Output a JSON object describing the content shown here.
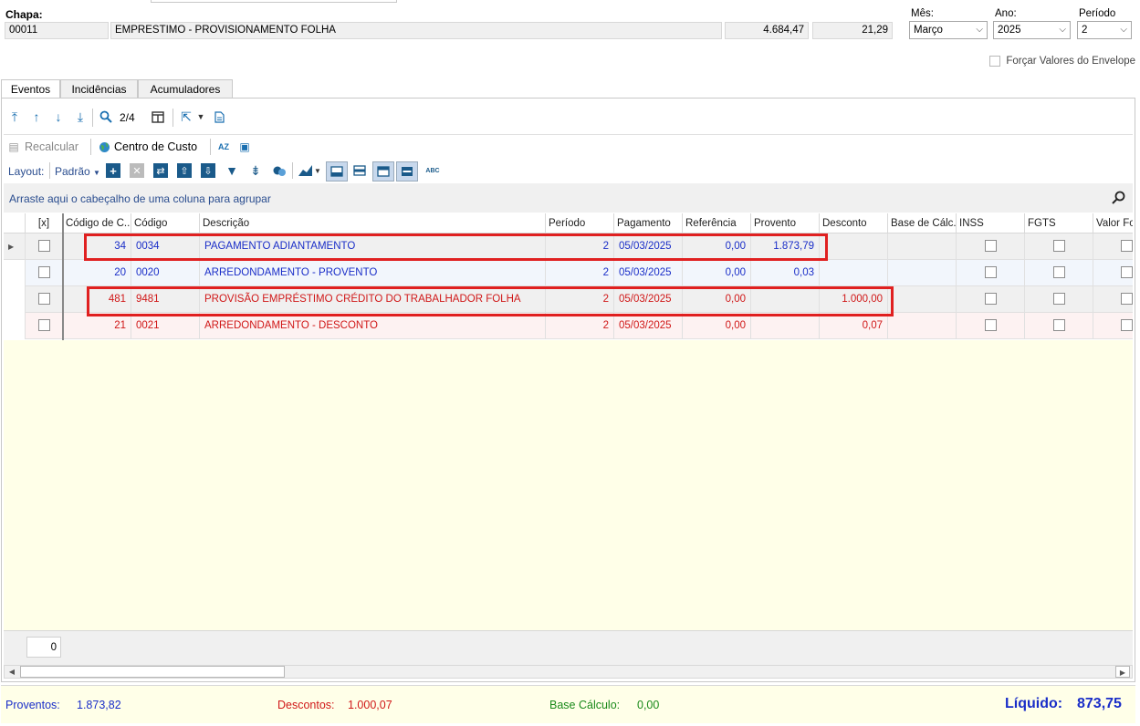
{
  "header": {
    "chapa_label": "Chapa:",
    "chapa_code": "00011",
    "chapa_desc": "EMPRESTIMO - PROVISIONAMENTO FOLHA",
    "value1": "4.684,47",
    "value2": "21,29",
    "mes_label": "Mês:",
    "mes_value": "Março",
    "ano_label": "Ano:",
    "ano_value": "2025",
    "periodo_label": "Período",
    "periodo_value": "2",
    "forcar_label": "Forçar Valores do Envelope"
  },
  "tabs": [
    {
      "label": "Eventos",
      "active": true
    },
    {
      "label": "Incidências",
      "active": false
    },
    {
      "label": "Acumuladores",
      "active": false
    }
  ],
  "toolbar": {
    "page_counter": "2/4",
    "recalcular": "Recalcular",
    "centro_custo": "Centro de Custo",
    "layout_label": "Layout:",
    "layout_value": "Padrão"
  },
  "grid": {
    "group_hint": "Arraste aqui o cabeçalho de uma coluna para agrupar",
    "columns": [
      "[x]",
      "Código de C...",
      "Código",
      "Descrição",
      "Período",
      "Pagamento",
      "Referência",
      "Provento",
      "Desconto",
      "Base de Cálc...",
      "INSS",
      "FGTS",
      "Valor Fo"
    ],
    "rows": [
      {
        "codc": "34",
        "codigo": "0034",
        "descricao": "PAGAMENTO ADIANTAMENTO",
        "periodo": "2",
        "pagamento": "05/03/2025",
        "referencia": "0,00",
        "provento": "1.873,79",
        "desconto": "",
        "color": "blue"
      },
      {
        "codc": "20",
        "codigo": "0020",
        "descricao": "ARREDONDAMENTO - PROVENTO",
        "periodo": "2",
        "pagamento": "05/03/2025",
        "referencia": "0,00",
        "provento": "0,03",
        "desconto": "",
        "color": "blue"
      },
      {
        "codc": "481",
        "codigo": "9481",
        "descricao": "PROVISÃO EMPRÉSTIMO CRÉDITO DO TRABALHADOR FOLHA",
        "periodo": "2",
        "pagamento": "05/03/2025",
        "referencia": "0,00",
        "provento": "",
        "desconto": "1.000,00",
        "color": "red"
      },
      {
        "codc": "21",
        "codigo": "0021",
        "descricao": "ARREDONDAMENTO - DESCONTO",
        "periodo": "2",
        "pagamento": "05/03/2025",
        "referencia": "0,00",
        "provento": "",
        "desconto": "0,07",
        "color": "red"
      }
    ],
    "footer_count": "0"
  },
  "totals": {
    "proventos_label": "Proventos:",
    "proventos_value": "1.873,82",
    "descontos_label": "Descontos:",
    "descontos_value": "1.000,07",
    "base_label": "Base Cálculo:",
    "base_value": "0,00",
    "liquido_label": "Líquido:",
    "liquido_value": "873,75"
  },
  "colors": {
    "proventos": "#1a2ec8",
    "descontos": "#d01818",
    "base": "#1a8a1a",
    "highlight": "#e02020"
  }
}
